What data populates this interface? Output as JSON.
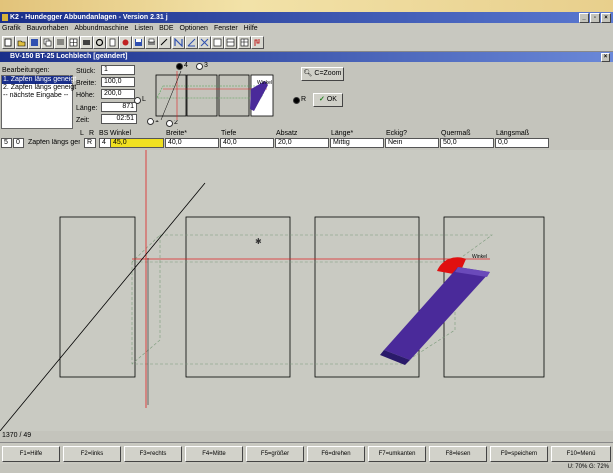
{
  "window": {
    "title": "K2 - Hundegger Abbundanlagen - Version 2.31 j",
    "doc_title": "BV-150   BT-25 Lochblech [geändert]"
  },
  "menu": [
    "Grafik",
    "Bauvorhaben",
    "Abbundmaschine",
    "Listen",
    "BDE",
    "Optionen",
    "Fenster",
    "Hilfe"
  ],
  "panel": {
    "bearbeitungen_label": "Bearbeitungen:",
    "list_items": [
      "1. Zapfen längs geneigt",
      "2. Zapfen längs geneigt",
      "-- nächste Eingabe --"
    ],
    "stueck_label": "Stück:",
    "stueck_value": "1",
    "breite_label": "Breite:",
    "breite_value": "100,0",
    "hoehe_label": "Höhe:",
    "hoehe_value": "200,0",
    "laenge_label": "Länge:",
    "laenge_value": "871",
    "zeit_label": "Zeit:",
    "zeit_value": "02:51",
    "radio_l": "L",
    "radio_r": "R",
    "radio_1": "1",
    "radio_2": "2",
    "radio_3": "3",
    "radio_4": "4",
    "winkel_tag": "Winkel",
    "zoom_label": "C=Zoom",
    "ok_label": "OK"
  },
  "headers": {
    "l": "L",
    "r": "R",
    "bs": "BS",
    "winkel": "Winkel",
    "breite": "Breite*",
    "tiefe": "Tiefe",
    "absatz": "Absatz",
    "laenge": "Länge*",
    "eckig": "Eckig?",
    "quermass": "Quermaß",
    "laengsmass": "Längsmaß"
  },
  "inputs": {
    "nr": "5",
    "seq": "0",
    "name": "Zapfen längs gene",
    "side": "R",
    "bs": "4",
    "winkel": "45,0",
    "breite": "40,0",
    "tiefe": "40,0",
    "absatz": "20,0",
    "laenge": "Mittig",
    "eckig": "Nein",
    "quermass": "50,0",
    "laengsmass": "0,0"
  },
  "canvas": {
    "winkel_tag": "Winkel"
  },
  "status": {
    "coords": "1370 / 49",
    "zoom": "U: 70% G: 72%"
  },
  "fkeys": [
    "F1=Hilfe",
    "F2=links",
    "F3=rechts",
    "F4=Mitte",
    "F5=größer",
    "F6=drehen",
    "F7=umkanten",
    "F8=lesen",
    "F9=speichern",
    "F10=Menü"
  ],
  "colors": {
    "titlebar": "#1a2f8a",
    "highlight_field": "#f0e020",
    "cut_shape": "#4a2a9a",
    "angle_marker": "#e01010"
  }
}
